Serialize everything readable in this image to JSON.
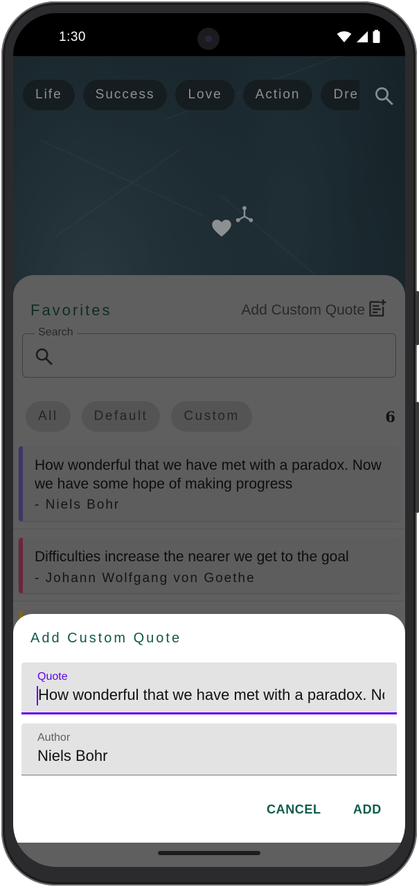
{
  "status_bar": {
    "time": "1:30"
  },
  "categories": {
    "items": [
      "Life",
      "Success",
      "Love",
      "Action",
      "Dre"
    ]
  },
  "favorites": {
    "title": "Favorites",
    "add_custom_label": "Add Custom Quote",
    "search_label": "Search",
    "filters": [
      "All",
      "Default",
      "Custom"
    ],
    "count": "6",
    "quotes": [
      {
        "text": "How wonderful that we have met with a paradox. Now we have some hope of making progress",
        "author": "- Niels Bohr",
        "accent": "#5c4e9c"
      },
      {
        "text": "Difficulties increase the nearer we get to the goal",
        "author": "- Johann Wolfgang von Goethe",
        "accent": "#a2355d"
      }
    ]
  },
  "dialog": {
    "title": "Add Custom Quote",
    "quote_label": "Quote",
    "quote_value": "How wonderful that we have met with a paradox. Now we have some hope of making progress",
    "author_label": "Author",
    "author_value": "Niels Bohr",
    "cancel_label": "CANCEL",
    "add_label": "ADD"
  },
  "colors": {
    "accent_primary": "#6200ee",
    "teal_text": "#12574a"
  },
  "icons": [
    "wifi-icon",
    "signal-icon",
    "battery-icon",
    "search-icon",
    "heart-icon",
    "share-icon",
    "note-add-icon"
  ]
}
